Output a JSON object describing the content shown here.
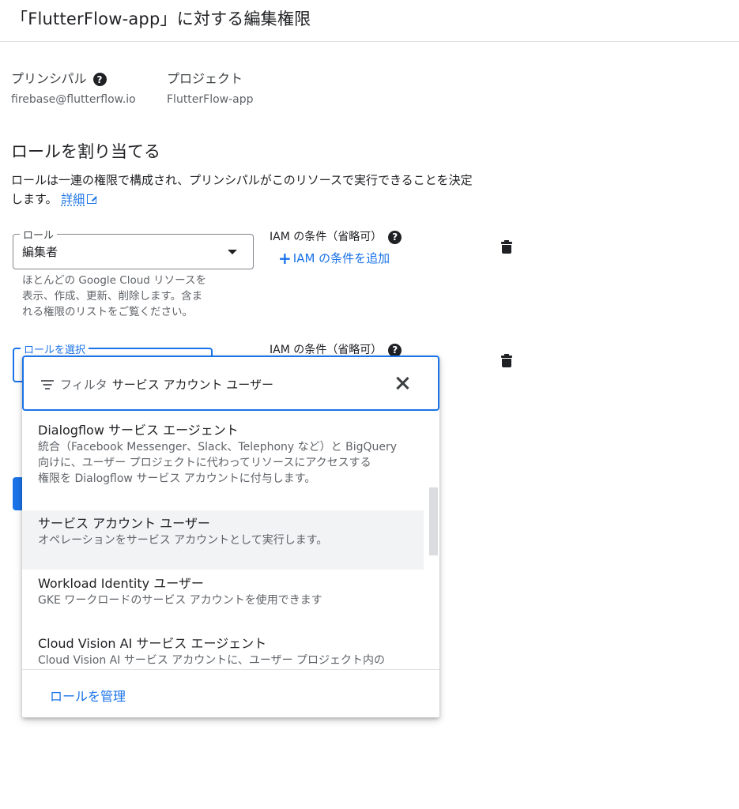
{
  "page_title": "「FlutterFlow-app」に対する編集権限",
  "principal": {
    "label": "プリンシパル",
    "value": "firebase@flutterflow.io"
  },
  "project": {
    "label": "プロジェクト",
    "value": "FlutterFlow-app"
  },
  "assign_section": {
    "title": "ロールを割り当てる",
    "desc_line1": "ロールは一連の権限で構成され、プリンシパルがこのリソースで実行できることを決定",
    "desc_line2": "します。",
    "details_link": "詳細"
  },
  "role1": {
    "field_label": "ロール",
    "value": "編集者",
    "help": [
      "ほとんどの Google Cloud リソースを",
      "表示、作成、更新、削除します。含ま",
      "れる権限のリストをご覧ください。"
    ],
    "iam_label": "IAM の条件（省略可）",
    "iam_add": "IAM の条件を追加"
  },
  "role2": {
    "field_label": "ロールを選択",
    "iam_label": "IAM の条件（省略可）"
  },
  "dropdown": {
    "filter_prefix": "フィルタ",
    "filter_value": "サービス アカウント ユーザー",
    "options": [
      {
        "title": "Dialogflow サービス エージェント",
        "desc": [
          "統合（Facebook Messenger、Slack、Telephony など）と BigQuery",
          "向けに、ユーザー プロジェクトに代わってリソースにアクセスする",
          "権限を Dialogflow サービス アカウントに付与します。"
        ]
      },
      {
        "title": "サービス アカウント ユーザー",
        "desc": [
          "オペレーションをサービス アカウントとして実行します。"
        ]
      },
      {
        "title": "Workload Identity ユーザー",
        "desc": [
          "GKE ワークロードのサービス アカウントを使用できます"
        ]
      },
      {
        "title": "Cloud Vision AI サービス エージェント",
        "desc": [
          "Cloud Vision AI サービス アカウントに、ユーザー プロジェクト内の"
        ]
      }
    ],
    "manage_roles": "ロールを管理"
  },
  "colors": {
    "accent": "#1a73e8",
    "text": "#202124",
    "muted": "#5f6368"
  },
  "icons": [
    "help-icon",
    "external-link-icon",
    "chevron-down-icon",
    "plus-icon",
    "trash-icon",
    "filter-icon",
    "close-icon"
  ]
}
